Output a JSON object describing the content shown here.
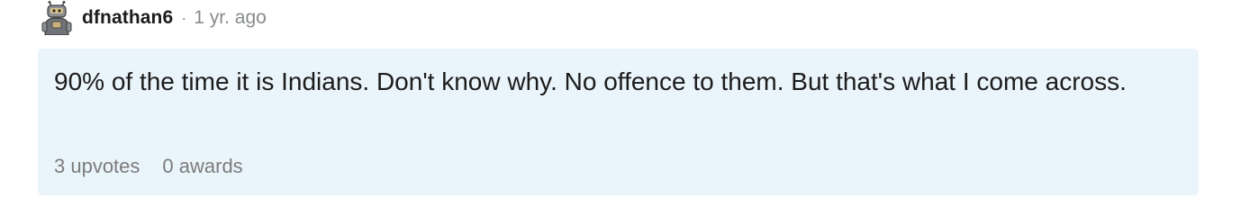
{
  "comment": {
    "author": {
      "username": "dfnathan6",
      "avatar_icon": "robot-avatar-icon"
    },
    "separator": "·",
    "timestamp": "1 yr. ago",
    "body": "90% of the time it is Indians. Don't know why. No offence to them. But that's what I come across.",
    "stats": {
      "upvotes": "3 upvotes",
      "awards": "0 awards"
    },
    "colors": {
      "card_background": "#eaf4fb",
      "text": "#1c1c1c",
      "muted": "#878a8c"
    }
  }
}
